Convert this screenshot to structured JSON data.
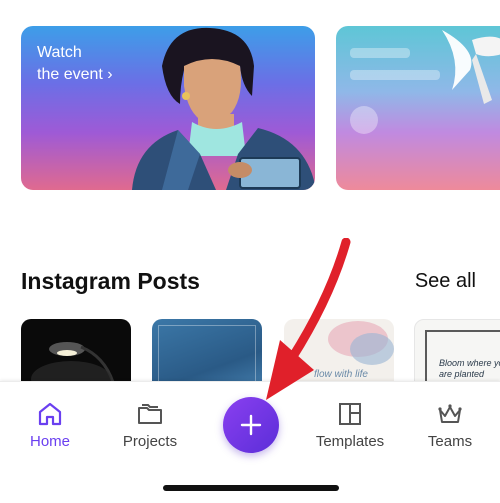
{
  "banners": {
    "first": {
      "line1": "Watch",
      "line2": "the event ›"
    }
  },
  "section": {
    "title": "Instagram Posts",
    "see_all": "See all"
  },
  "thumbnails": [
    {
      "caption": ""
    },
    {
      "caption": ""
    },
    {
      "caption": "flow with life"
    },
    {
      "caption_lines": [
        "Bloom where you",
        "are planted"
      ]
    }
  ],
  "nav": {
    "items": [
      {
        "label": "Home",
        "icon": "home-icon",
        "active": true
      },
      {
        "label": "Projects",
        "icon": "folder-icon",
        "active": false
      },
      {
        "label": "Templates",
        "icon": "templates-icon",
        "active": false
      },
      {
        "label": "Teams",
        "icon": "crown-icon",
        "active": false
      }
    ],
    "create_icon": "plus-icon"
  },
  "colors": {
    "accent": "#6a3ff0",
    "fab": "#7b3ae6",
    "annotation_arrow": "#e0202a"
  }
}
